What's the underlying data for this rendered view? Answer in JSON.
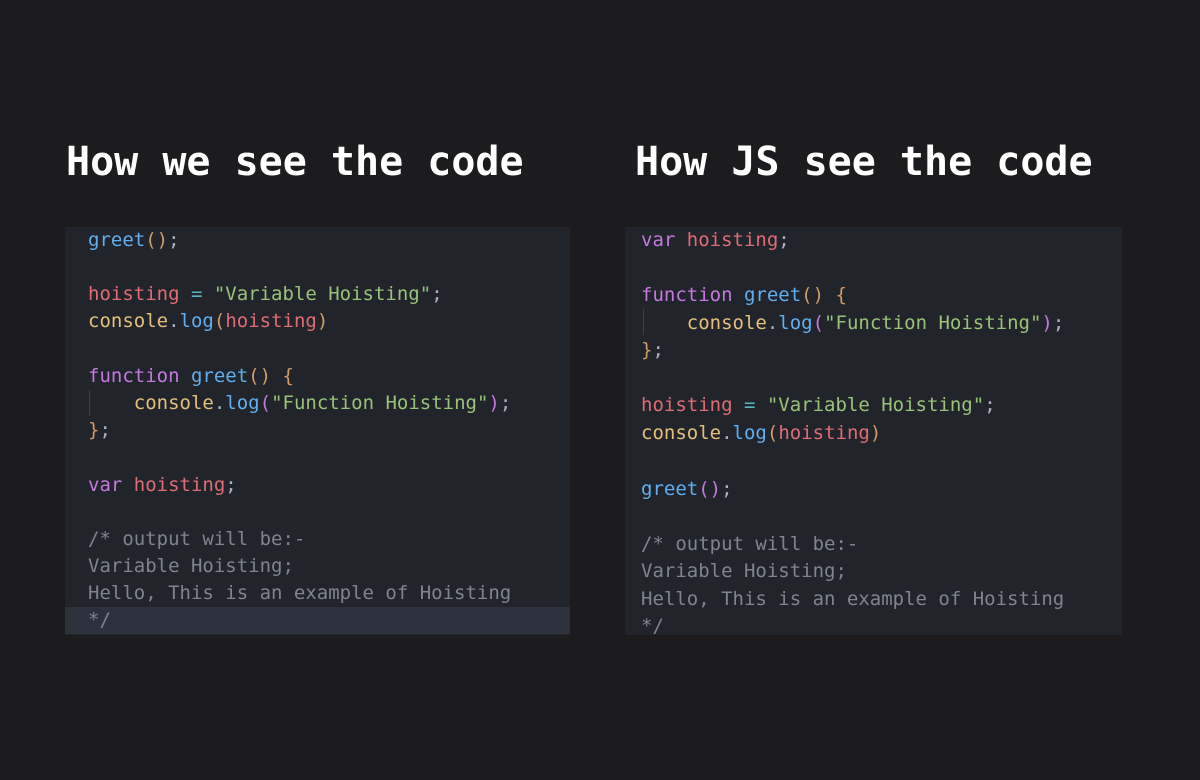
{
  "headings": {
    "left": "How we see the code",
    "right": "How JS see the code"
  },
  "left_panel": {
    "line1": {
      "fn": "greet",
      "paren": "()",
      "semi": ";"
    },
    "line3": {
      "var": "hoisting",
      "op": " = ",
      "str": "\"Variable Hoisting\"",
      "semi": ";"
    },
    "line4": {
      "obj": "console",
      "dot": ".",
      "fn": "log",
      "open": "(",
      "var": "hoisting",
      "close": ")"
    },
    "line6": {
      "kw": "function",
      "fn": "greet",
      "paren": "()",
      "brace": "{"
    },
    "line7": {
      "obj": "console",
      "dot": ".",
      "fn": "log",
      "open": "(",
      "str": "\"Function Hoisting\"",
      "close": ")",
      "semi": ";"
    },
    "line8": {
      "brace": "}",
      "semi": ";"
    },
    "line10": {
      "kw": "var",
      "var": "hoisting",
      "semi": ";"
    },
    "comment": [
      "/* output will be:-",
      "Variable Hoisting;",
      "Hello, This is an example of Hoisting",
      "*/"
    ]
  },
  "right_panel": {
    "line1": {
      "kw": "var",
      "var": "hoisting",
      "semi": ";"
    },
    "line3": {
      "kw": "function",
      "fn": "greet",
      "paren": "()",
      "brace": "{"
    },
    "line4": {
      "obj": "console",
      "dot": ".",
      "fn": "log",
      "open": "(",
      "str": "\"Function Hoisting\"",
      "close": ")",
      "semi": ";"
    },
    "line5": {
      "brace": "}",
      "semi": ";"
    },
    "line7": {
      "var": "hoisting",
      "op": " = ",
      "str": "\"Variable Hoisting\"",
      "semi": ";"
    },
    "line8": {
      "obj": "console",
      "dot": ".",
      "fn": "log",
      "open": "(",
      "var": "hoisting",
      "close": ")"
    },
    "line10": {
      "fn": "greet",
      "paren": "()",
      "semi": ";"
    },
    "comment": [
      "/* output will be:-",
      "Variable Hoisting;",
      "Hello, This is an example of Hoisting",
      "*/"
    ]
  },
  "colors": {
    "background": "#1c1b1d",
    "panel": "#21252b",
    "keyword": "#c678dd",
    "function": "#61afef",
    "variable": "#e06c75",
    "string": "#98c379",
    "object": "#e5c07b",
    "bracket": "#d19a66",
    "comment": "#7f848e"
  }
}
